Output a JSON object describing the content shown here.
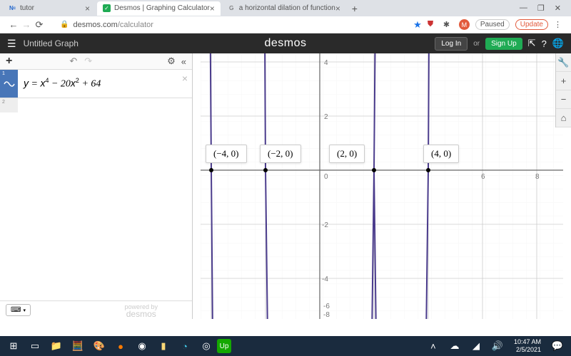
{
  "browser": {
    "tabs": [
      {
        "title": "tutor",
        "icon": "N"
      },
      {
        "title": "Desmos | Graphing Calculator",
        "icon": "D",
        "active": true
      },
      {
        "title": "a horizontal dilation of function",
        "icon": "G"
      }
    ],
    "url_host": "desmos.com",
    "url_path": "/calculator",
    "paused": "Paused",
    "update": "Update",
    "avatar": "M"
  },
  "header": {
    "title": "Untitled Graph",
    "logo": "desmos",
    "login": "Log In",
    "or": "or",
    "signup": "Sign Up"
  },
  "expressions": [
    {
      "index": "1",
      "latex": "y = x⁴ − 20x² + 64"
    }
  ],
  "footer": {
    "powered_sub": "powered by",
    "powered": "desmos"
  },
  "chart_data": {
    "type": "line",
    "function": "y = x^4 - 20x^2 + 64",
    "roots": [
      [
        -4,
        0
      ],
      [
        -2,
        0
      ],
      [
        2,
        0
      ],
      [
        4,
        0
      ]
    ],
    "point_labels": [
      "(−4, 0)",
      "(−2, 0)",
      "(2, 0)",
      "(4, 0)"
    ],
    "xlim": [
      -5,
      8.5
    ],
    "ylim": [
      -8.5,
      5.5
    ],
    "x_ticks": [
      0,
      6,
      8
    ],
    "y_ticks": [
      -8,
      -6,
      -4,
      -2,
      2,
      4
    ],
    "curve_color": "#4a3b8c"
  },
  "system": {
    "time": "10:47 AM",
    "date": "2/5/2021"
  }
}
